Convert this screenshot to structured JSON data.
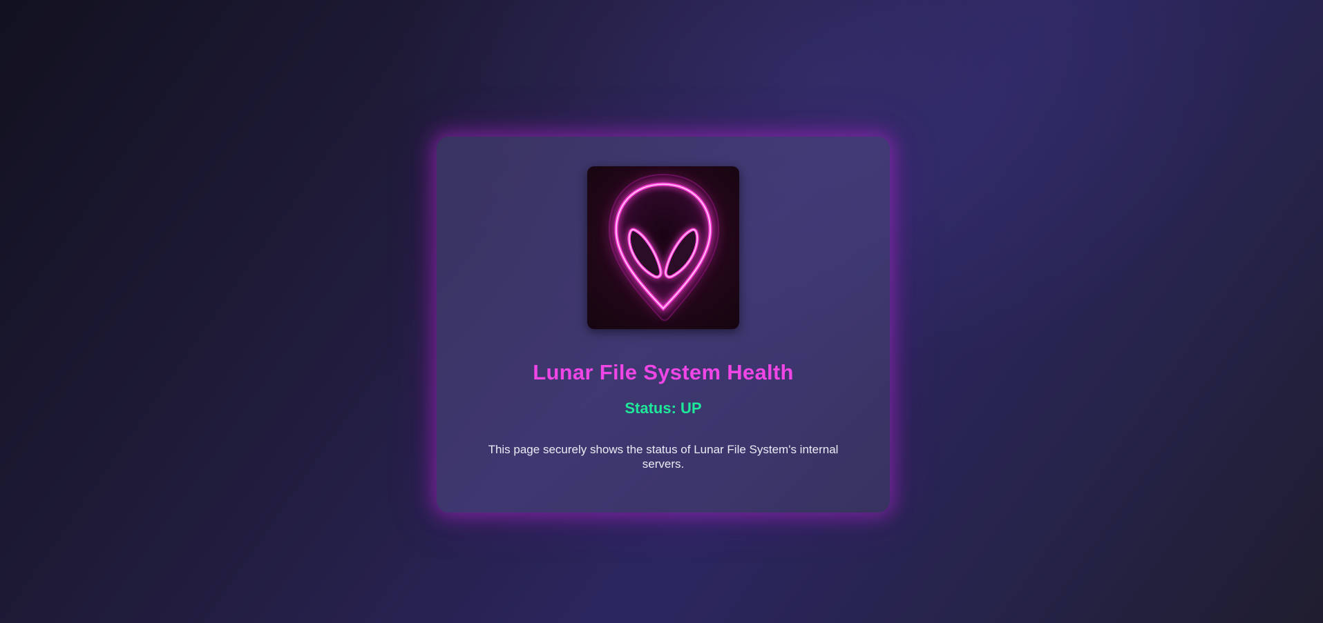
{
  "page": {
    "title": "Lunar File System Health",
    "status_text": "Status: UP",
    "description": "This page securely shows the status of Lunar File System's internal servers."
  },
  "logo": {
    "icon": "neon-alien-head-icon",
    "color": "#ff3fd8"
  },
  "colors": {
    "title": "#f046e6",
    "status_up": "#1ee89a",
    "card_glow": "#aa28c8",
    "description": "#ecebf5"
  }
}
